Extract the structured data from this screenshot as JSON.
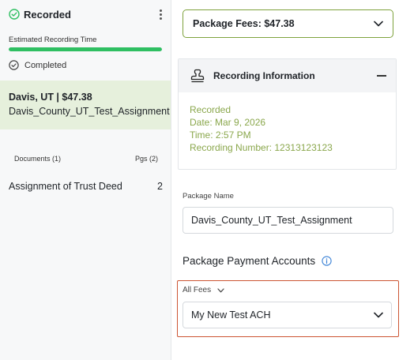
{
  "left_panel": {
    "status_title": "Recorded",
    "est_label": "Estimated Recording Time",
    "progress_fraction": 1.0,
    "completed_label": "Completed",
    "package": {
      "location_fee": "Davis, UT | $47.38",
      "name": "Davis_County_UT_Test_Assignment"
    },
    "documents_header": "Documents (1)",
    "pages_header": "Pgs (2)",
    "documents": [
      {
        "name": "Assignment of Trust Deed",
        "pages": "2"
      }
    ]
  },
  "right_panel": {
    "fees_dropdown": "Package Fees: $47.38",
    "recording_info": {
      "title": "Recording Information",
      "lines": [
        "Recorded",
        "Date: Mar 9, 2026",
        "Time: 2:57 PM",
        "Recording Number: 12313123123"
      ]
    },
    "package_name_label": "Package Name",
    "package_name_value": "Davis_County_UT_Test_Assignment",
    "payment_accounts_title": "Package Payment Accounts",
    "fee_filter": "All Fees",
    "account_selected": "My New Test ACH"
  },
  "colors": {
    "progress": "#2fbf62",
    "package_card_bg": "#e6f0dc",
    "recording_text": "#8aa74c",
    "highlight_border": "#cc5533",
    "fees_border": "#7ea23c",
    "info_icon": "#3b82d6"
  }
}
